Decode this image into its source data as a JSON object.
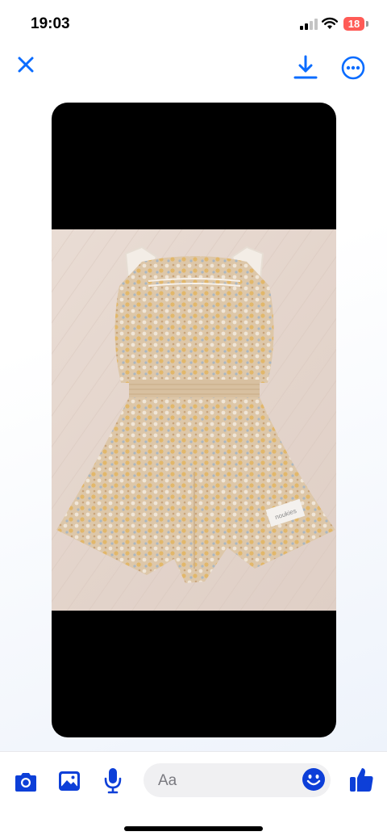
{
  "status_bar": {
    "time": "19:03",
    "battery": "18",
    "icons": [
      "signal-icon",
      "wifi-icon",
      "battery-icon"
    ]
  },
  "top_nav": {
    "icons": [
      "close-icon",
      "download-icon",
      "more-icon"
    ]
  },
  "colors": {
    "accent": "#0a6cff",
    "bottom_accent": "#0d3fd8",
    "battery_low": "#ff5b56"
  },
  "photo": {
    "label_tag": "noukies"
  },
  "composer": {
    "placeholder": "Aa",
    "icons": [
      "camera-icon",
      "gallery-icon",
      "microphone-icon",
      "emoji-icon",
      "thumbs-up-icon"
    ]
  }
}
